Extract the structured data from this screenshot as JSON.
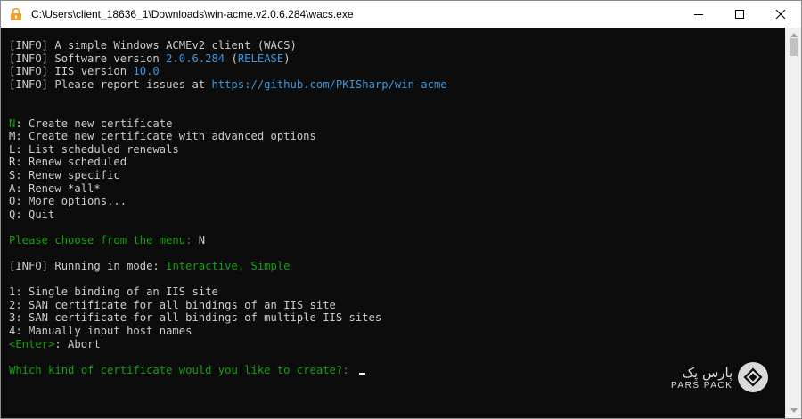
{
  "window": {
    "title": "C:\\Users\\client_18636_1\\Downloads\\win-acme.v2.0.6.284\\wacs.exe",
    "controls": [
      "minimize",
      "maximize",
      "close"
    ]
  },
  "terminal": {
    "lines": [
      [
        {
          "t": "[INFO] A simple Windows ACMEv2 client (WACS)",
          "c": ""
        }
      ],
      [
        {
          "t": "[INFO] Software version ",
          "c": ""
        },
        {
          "t": "2.0.6.284",
          "c": "c"
        },
        {
          "t": " (",
          "c": ""
        },
        {
          "t": "RELEASE",
          "c": "c"
        },
        {
          "t": ")",
          "c": ""
        }
      ],
      [
        {
          "t": "[INFO] IIS version ",
          "c": ""
        },
        {
          "t": "10.0",
          "c": "c"
        }
      ],
      [
        {
          "t": "[INFO] Please report issues at ",
          "c": ""
        },
        {
          "t": "https://github.com/PKISharp/win-acme",
          "c": "c"
        }
      ],
      [],
      [],
      [
        {
          "t": "N",
          "c": "g"
        },
        {
          "t": ": Create new certificate",
          "c": ""
        }
      ],
      [
        {
          "t": "M: Create new certificate with advanced options",
          "c": ""
        }
      ],
      [
        {
          "t": "L: List scheduled renewals",
          "c": ""
        }
      ],
      [
        {
          "t": "R: Renew scheduled",
          "c": ""
        }
      ],
      [
        {
          "t": "S: Renew specific",
          "c": ""
        }
      ],
      [
        {
          "t": "A: Renew *all*",
          "c": ""
        }
      ],
      [
        {
          "t": "O: More options...",
          "c": ""
        }
      ],
      [
        {
          "t": "Q: Quit",
          "c": ""
        }
      ],
      [],
      [
        {
          "t": "Please choose from the menu: ",
          "c": "g"
        },
        {
          "t": "N",
          "c": ""
        }
      ],
      [],
      [
        {
          "t": "[INFO] Running in mode: ",
          "c": ""
        },
        {
          "t": "Interactive, Simple",
          "c": "g"
        }
      ],
      [],
      [
        {
          "t": "1: Single binding of an IIS site",
          "c": ""
        }
      ],
      [
        {
          "t": "2: SAN certificate for all bindings of an IIS site",
          "c": ""
        }
      ],
      [
        {
          "t": "3: SAN certificate for all bindings of multiple IIS sites",
          "c": ""
        }
      ],
      [
        {
          "t": "4: Manually input host names",
          "c": ""
        }
      ],
      [
        {
          "t": "<Enter>",
          "c": "g"
        },
        {
          "t": ": Abort",
          "c": ""
        }
      ],
      [],
      [
        {
          "t": "Which kind of certificate would you like to create?: ",
          "c": "g"
        }
      ]
    ],
    "colors": {
      "default": "#cccccc",
      "green": "#13a10e",
      "cyan": "#3a96dd",
      "background": "#0c0c0c"
    }
  },
  "watermark": {
    "fa": "پارس پک",
    "en": "PARS PACK",
    "logo_icon": "diamond-logo-icon"
  }
}
